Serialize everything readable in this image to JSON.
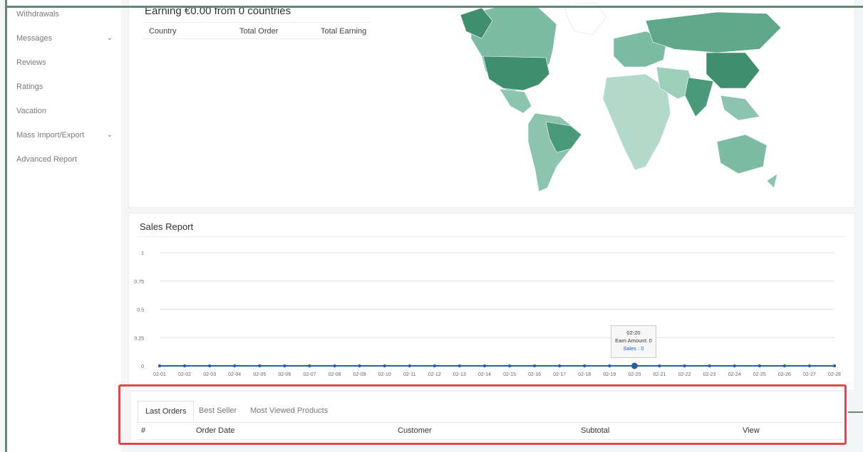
{
  "sidebar": {
    "items": [
      {
        "label": "Withdrawals",
        "has_chevron": false
      },
      {
        "label": "Messages",
        "has_chevron": true
      },
      {
        "label": "Reviews",
        "has_chevron": false
      },
      {
        "label": "Ratings",
        "has_chevron": false
      },
      {
        "label": "Vacation",
        "has_chevron": false
      },
      {
        "label": "Mass Import/Export",
        "has_chevron": true
      },
      {
        "label": "Advanced Report",
        "has_chevron": false
      }
    ],
    "chevron_glyph": "⌄"
  },
  "earning": {
    "title": "Earning €0.00 from 0 countries",
    "columns": [
      "Country",
      "Total Order",
      "Total Earning"
    ],
    "map_color": "#4a9a7a"
  },
  "sales_report": {
    "title": "Sales Report",
    "tooltip": {
      "date": "02-20",
      "earn": "Earn Amount: 0",
      "sales": "Sales : 0"
    }
  },
  "chart_data": {
    "type": "line",
    "title": "Sales Report",
    "x": [
      "02-01",
      "02-02",
      "02-03",
      "02-04",
      "02-05",
      "02-06",
      "02-07",
      "02-08",
      "02-09",
      "02-10",
      "02-11",
      "02-12",
      "02-13",
      "02-14",
      "02-15",
      "02-16",
      "02-17",
      "02-18",
      "02-19",
      "02-20",
      "02-21",
      "02-22",
      "02-23",
      "02-24",
      "02-25",
      "02-26",
      "02-27",
      "02-28"
    ],
    "series": [
      {
        "values": [
          0,
          0,
          0,
          0,
          0,
          0,
          0,
          0,
          0,
          0,
          0,
          0,
          0,
          0,
          0,
          0,
          0,
          0,
          0,
          0,
          0,
          0,
          0,
          0,
          0,
          0,
          0,
          0
        ],
        "color": "#2d5f9a"
      }
    ],
    "ylim": [
      0,
      1
    ],
    "yticks": [
      "0",
      "0.25",
      "0.5",
      "0.75",
      "1"
    ],
    "grid": true,
    "highlighted_point": "02-20"
  },
  "orders": {
    "tabs": [
      "Last Orders",
      "Best Seller",
      "Most Viewed Products"
    ],
    "active_tab": "Last Orders",
    "columns": [
      "#",
      "Order Date",
      "Customer",
      "Subtotal",
      "View"
    ]
  },
  "highlight_color": "#e0484d"
}
